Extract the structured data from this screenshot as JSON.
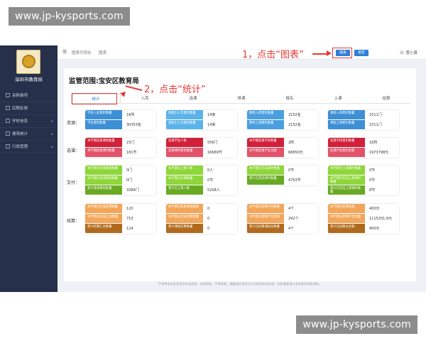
{
  "watermark": "www.jp-kysports.com",
  "sidebar": {
    "logo_text": "深圳市教育局",
    "items": [
      {
        "label": "采购事项"
      },
      {
        "label": "后期反馈"
      },
      {
        "label": "学校信息"
      },
      {
        "label": "报表统计"
      },
      {
        "label": "行政管理"
      }
    ]
  },
  "topbar": {
    "crumb1": "图表可视化",
    "crumb2": "图表",
    "btn_chart": "图表",
    "btn_report": "报告",
    "user": "管小黄"
  },
  "annotation1": "1，点击“图表”",
  "annotation2": "2，点击“统计”",
  "scope_title": "监管范围:宝安区教育局",
  "tabs": [
    {
      "label": "统计"
    },
    {
      "label": "入库"
    },
    {
      "label": "选课"
    },
    {
      "label": "排课"
    },
    {
      "label": "报名"
    },
    {
      "label": "上课"
    },
    {
      "label": "结算"
    }
  ],
  "rows": [
    {
      "label": "资源：",
      "cards": [
        {
          "cells": [
            {
              "label": "学校入驻累积数量",
              "value": "16所",
              "color": "#3d8fd6"
            },
            {
              "label": "学生累积数量",
              "value": "30353名",
              "color": "#3d8fd6"
            }
          ]
        },
        {
          "cells": [
            {
              "label": "课程引入年累积数量",
              "value": "14家",
              "color": "#5bb3ea"
            },
            {
              "label": "课程引入月累积数量",
              "value": "14家",
              "color": "#5bb3ea"
            }
          ]
        },
        {
          "cells": [
            {
              "label": "教师入库累积数量",
              "value": "2152名",
              "color": "#4a9fe0"
            },
            {
              "label": "教师上课累积数量",
              "value": "2152名",
              "color": "#4a9fe0"
            }
          ]
        },
        {
          "cells": [
            {
              "label": "课程入库累积数量",
              "value": "1511门",
              "color": "#3d8fd6"
            },
            {
              "label": "课程上课累积数量",
              "value": "1511门",
              "color": "#3d8fd6"
            }
          ]
        }
      ]
    },
    {
      "label": "选课：",
      "cards": [
        {
          "cells": [
            {
              "label": "本学期选课课程数量",
              "value": "23门",
              "color": "#d2203a"
            },
            {
              "label": "本学期选课课时数量",
              "value": "181节",
              "color": "#e2536a"
            }
          ]
        },
        {
          "cells": [
            {
              "label": "选课学生人数",
              "value": "556门",
              "color": "#d2203a"
            },
            {
              "label": "选课课时累积数量",
              "value": "16689节",
              "color": "#e2536a"
            }
          ]
        },
        {
          "cells": [
            {
              "label": "本学期选课学校数量",
              "value": "2所",
              "color": "#d2203a"
            },
            {
              "label": "本学期选课产生金额",
              "value": "68850元",
              "color": "#e2536a"
            }
          ]
        },
        {
          "cells": [
            {
              "label": "选课学校累积数量",
              "value": "16所",
              "color": "#d2203a"
            },
            {
              "label": "选课产生累积金额",
              "value": "1973798元",
              "color": "#e2536a"
            }
          ]
        }
      ]
    },
    {
      "label": "交付：",
      "cards": [
        {
          "cells": [
            {
              "label": "本学期已开课课程数量",
              "value": "0门",
              "color": "#8ed63a"
            },
            {
              "label": "本学期已排课课程数量",
              "value": "0门",
              "color": "#8ed63a"
            },
            {
              "label": "累计排课课程数量",
              "value": "3384门",
              "color": "#6aaa23"
            }
          ]
        },
        {
          "cells": [
            {
              "label": "本学期已上课人数",
              "value": "0人",
              "color": "#8ed63a"
            },
            {
              "label": "本学期已开课数量",
              "value": "0节",
              "color": "#8ed63a"
            },
            {
              "label": "累计已上课人数",
              "value": "5208人",
              "color": "#6aaa23"
            }
          ]
        },
        {
          "cells": [
            {
              "label": "本学期已完成课时数量",
              "value": "0节",
              "color": "#8ed63a"
            },
            {
              "label": "累计已完成课时数量",
              "value": "4763节",
              "color": "#6aaa23"
            }
          ]
        },
        {
          "cells": [
            {
              "label": "本学期已上课课时数量",
              "value": "0节",
              "color": "#8ed63a"
            },
            {
              "label": "本学期已完成上课课时数量",
              "value": "0节",
              "color": "#8ed63a"
            },
            {
              "label": "累计已完成上课课时数量",
              "value": "8节",
              "color": "#6aaa23"
            }
          ]
        }
      ]
    },
    {
      "label": "结算：",
      "cards": [
        {
          "cells": [
            {
              "label": "本学期已完成结算数量",
              "value": "120",
              "color": "#f2a65a"
            },
            {
              "label": "本学期已完成汇总数量",
              "value": "710",
              "color": "#f2a65a"
            },
            {
              "label": "累计结算汇总数量",
              "value": "124",
              "color": "#b06a1e"
            }
          ]
        },
        {
          "cells": [
            {
              "label": "本学期已结算课程数量",
              "value": "0",
              "color": "#f2a65a"
            },
            {
              "label": "本学期已完成结算数量",
              "value": "0",
              "color": "#f2a65a"
            },
            {
              "label": "累计课程结算数量",
              "value": "0",
              "color": "#b06a1e"
            }
          ]
        },
        {
          "cells": [
            {
              "label": "本学期已结算学校数量",
              "value": "4个",
              "color": "#f2a65a"
            },
            {
              "label": "本学期已结算产生金额",
              "value": "292个",
              "color": "#f2a65a"
            },
            {
              "label": "累计已结算课程总数量",
              "value": "4个",
              "color": "#b06a1e"
            }
          ]
        },
        {
          "cells": [
            {
              "label": "本学期已结算金额",
              "value": "400元",
              "color": "#f2a65a"
            },
            {
              "label": "本学期已结算产生金额",
              "value": "1115201.6元",
              "color": "#f2a65a"
            },
            {
              "label": "累计已结算总金额",
              "value": "400元",
              "color": "#b06a1e"
            }
          ]
        }
      ]
    }
  ],
  "footer": "严禁将本站信息用作商业用途，未经授权，不得转载、摘编或利用其它方式使用本站内容；如有需要请与本站联系获取授权。"
}
